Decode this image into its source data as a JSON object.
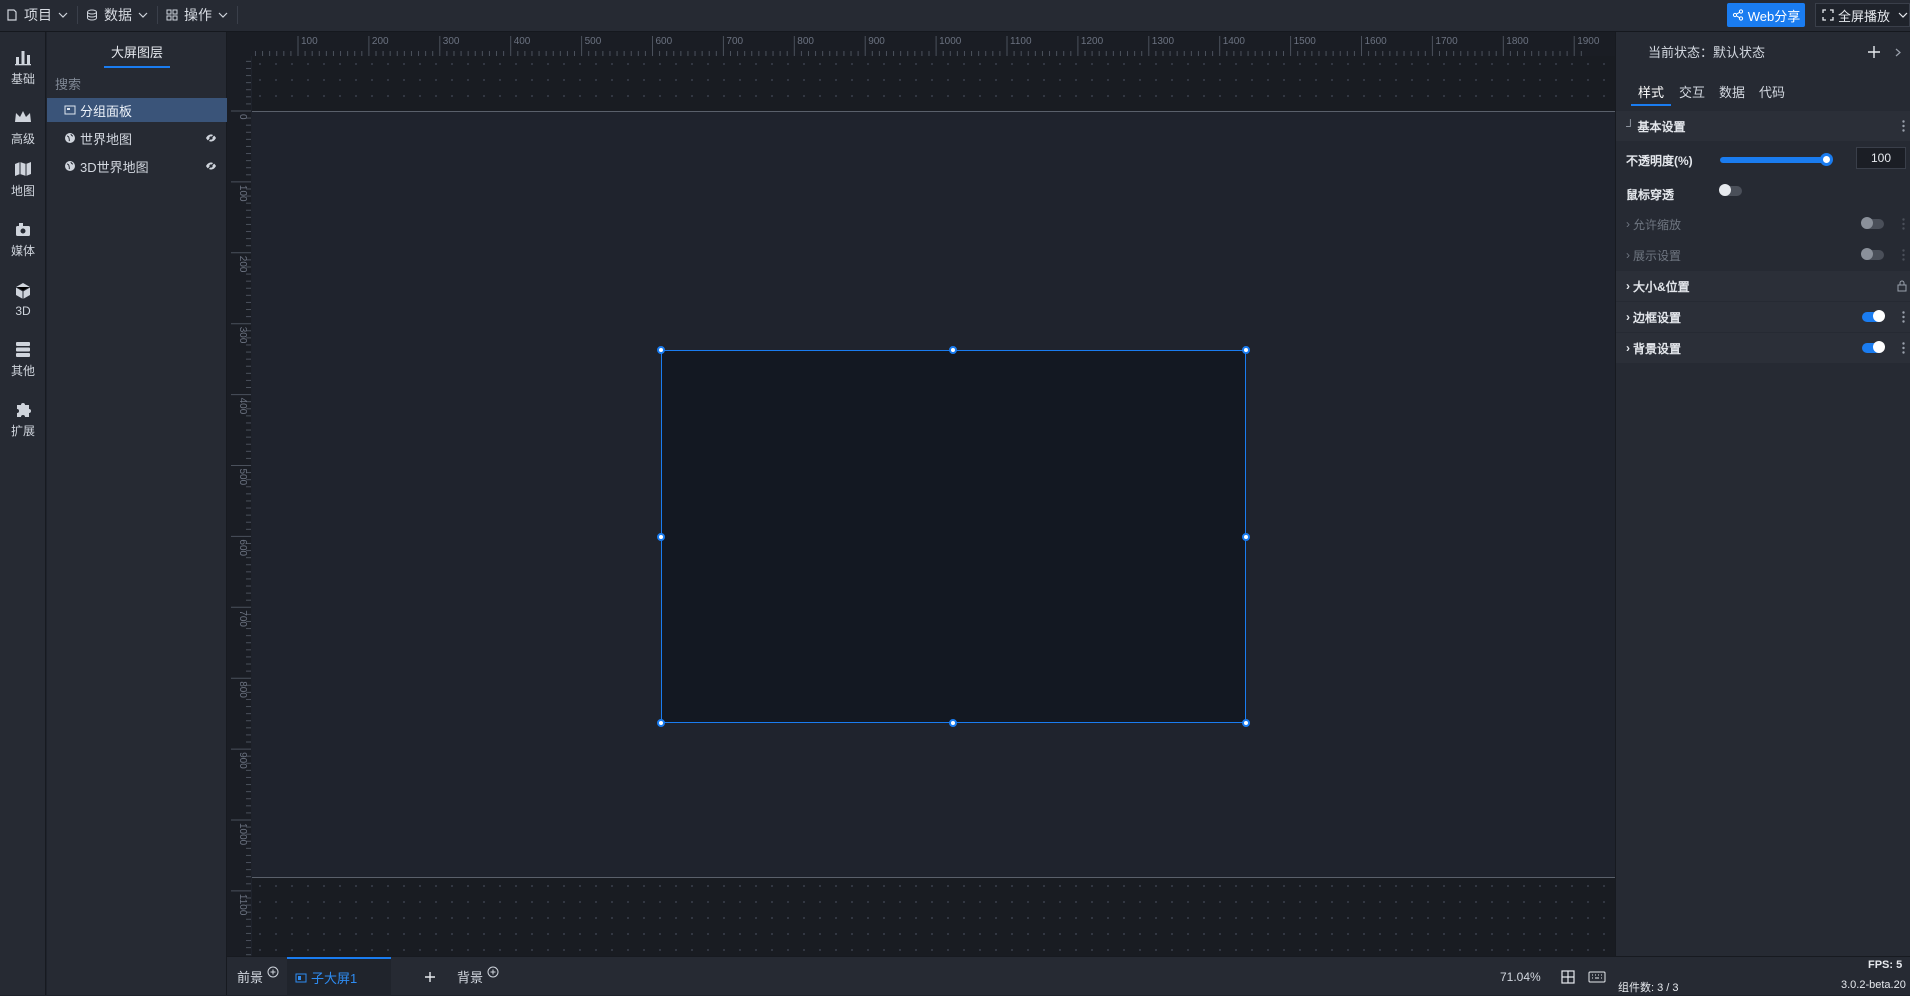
{
  "topbar": {
    "menus": [
      {
        "label": "项目",
        "icon": "file-icon"
      },
      {
        "label": "数据",
        "icon": "database-icon"
      },
      {
        "label": "操作",
        "icon": "grid-icon"
      }
    ],
    "share_label": "Web分享",
    "fullscreen_label": "全屏播放"
  },
  "rail": [
    {
      "label": "基础",
      "icon": "bar-chart-icon"
    },
    {
      "label": "高级",
      "icon": "crown-icon"
    },
    {
      "label": "地图",
      "icon": "map-icon"
    },
    {
      "label": "媒体",
      "icon": "media-icon"
    },
    {
      "label": "3D",
      "icon": "cube-icon"
    },
    {
      "label": "其他",
      "icon": "stack-icon"
    },
    {
      "label": "扩展",
      "icon": "puzzle-icon"
    }
  ],
  "layers": {
    "tab_label": "大屏图层",
    "search_placeholder": "搜索",
    "items": [
      {
        "label": "分组面板",
        "icon": "panel-icon",
        "selected": true,
        "hidden": false
      },
      {
        "label": "世界地图",
        "icon": "globe-icon",
        "selected": false,
        "hidden": true
      },
      {
        "label": "3D世界地图",
        "icon": "globe-icon",
        "selected": false,
        "hidden": true
      }
    ]
  },
  "ruler": {
    "top_ticks": [
      "100",
      "200",
      "300",
      "400",
      "500",
      "600",
      "700",
      "800",
      "900",
      "1000",
      "1100",
      "1200",
      "1300",
      "1400",
      "1500",
      "1600",
      "1700",
      "1800",
      "1900"
    ],
    "left_ticks": [
      "0",
      "100",
      "200",
      "300",
      "400",
      "500",
      "600",
      "700",
      "800",
      "900",
      "1000",
      "1100"
    ]
  },
  "bottombar": {
    "foreground_label": "前景",
    "subscreen_label": "子大屏1",
    "background_label": "背景",
    "zoom": "71.04%"
  },
  "rightpanel": {
    "state_label": "当前状态：默认状态",
    "tabs": [
      "样式",
      "交互",
      "数据",
      "代码"
    ],
    "active_tab": "样式",
    "sections": {
      "basic": "基本设置",
      "opacity_label": "不透明度(%)",
      "opacity_value": "100",
      "mouse_through": "鼠标穿透",
      "allow_zoom": "允许缩放",
      "display": "展示设置",
      "size_position": "大小&位置",
      "border": "边框设置",
      "background": "背景设置"
    }
  },
  "status": {
    "fps": "FPS: 5",
    "components": "组件数: 3 / 3",
    "version": "3.0.2-beta.20"
  },
  "colors": {
    "accent": "#1a7cf0",
    "selected_layer": "#3a5479",
    "stage_bg": "#1f232d",
    "panel_bg": "#131822"
  }
}
